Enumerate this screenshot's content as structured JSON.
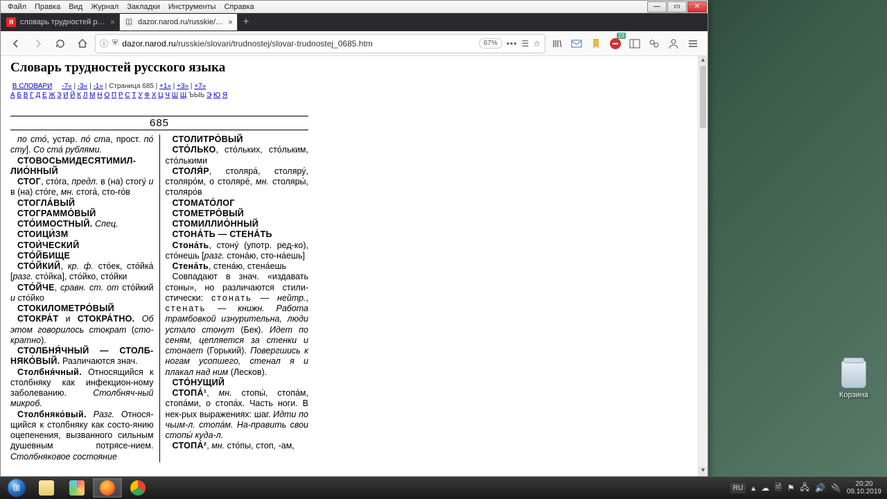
{
  "menubar": [
    "Файл",
    "Правка",
    "Вид",
    "Журнал",
    "Закладки",
    "Инструменты",
    "Справка"
  ],
  "tabs": [
    {
      "label": "словарь трудностей русского",
      "favicon": "Я",
      "active": false
    },
    {
      "label": "dazor.narod.ru/russkie/slovari/",
      "favicon": "◫",
      "active": true
    }
  ],
  "url": {
    "scheme_icon": "ⓘ",
    "shield_icon": "🛡",
    "host": "dazor.narod.ru",
    "path": "/russkie/slovari/trudnostej/slovar-trudnostej_0685.htm",
    "zoom": "67%"
  },
  "toolbar_badge": "23",
  "page": {
    "title": "Словарь трудностей русского языка",
    "back_link": "В СЛОВАРИ",
    "pager": [
      "-7«",
      "-3«",
      "-1«",
      "Страница  685",
      "+1»",
      "+3»",
      "+7»"
    ],
    "alphabet": [
      "А",
      "Б",
      "В",
      "Г",
      "Д",
      "Е",
      "Ж",
      "З",
      "И",
      "Й",
      "К",
      "Л",
      "М",
      "Н",
      "О",
      "П",
      "Р",
      "С",
      "Т",
      "У",
      "Ф",
      "Х",
      "Ц",
      "Ч",
      "Ш",
      "Щ",
      "ЪЫЬ",
      "Э",
      "Ю",
      "Я"
    ],
    "pagenum": "685",
    "col1": [
      {
        "html": "<span class='it'>по сто́</span>, устар. <span class='it'>по́ ста</span>, прост. <span class='it'>по́ сту</span>]. <span class='it'>Со ста́ рублями.</span>"
      },
      {
        "html": "<span class='hw'>СТОВОСЬМИДЕСЯТИМИЛ-ЛИО́ННЫЙ</span>"
      },
      {
        "html": "<span class='hw'>СТОГ</span>, сто́га, <span class='it'>предл.</span> в (на) стогу́ <span class='it'>и</span> в (на) сто́ге, <span class='it'>мн.</span> стога́, сто-го́в"
      },
      {
        "html": "<span class='hw'>СТОГЛА́ВЫЙ</span>"
      },
      {
        "html": "<span class='hw'>СТОГРАММО́ВЫЙ</span>"
      },
      {
        "html": "<span class='hw'>СТО́ИМОСТНЫЙ.</span> <span class='it'>Спец.</span>"
      },
      {
        "html": "<span class='hw'>СТОИЦИ́ЗМ</span>"
      },
      {
        "html": "<span class='hw'>СТОИ́ЧЕСКИЙ</span>"
      },
      {
        "html": "<span class='hw'>СТО́ЙБИЩЕ</span>"
      },
      {
        "html": "<span class='hw'>СТО́ЙКИЙ</span>, <span class='it'>кр. ф.</span> сто́ек, сто́йка́ [<span class='it'>разг.</span> сто́йка], сто́йко, сто́йки"
      },
      {
        "html": "<span class='hw'>СТО́ЙЧЕ</span>, <span class='it'>сравн. ст. от</span> сто́йкий <span class='it'>и</span> сто́йко"
      },
      {
        "html": "<span class='hw'>СТОКИЛОМЕТРО́ВЫЙ</span>"
      },
      {
        "html": "<span class='hw'>СТОКРА́Т</span> и <span class='hw'>СТОКРА́ТНО.</span> <span class='it'>Об этом говорилось стократ</span> (<span class='it'>сто-кратно</span>)."
      },
      {
        "html": "<span class='hw'>СТОЛБНЯ́ЧНЫЙ — СТОЛБ-НЯКО́ВЫЙ.</span> Различаются знач."
      },
      {
        "html": "<span class='hw'>Столбня́чный.</span> Относящийся к столбняку как инфекцион-ному заболеванию. <span class='it'>Столбняч-ный микроб.</span>"
      },
      {
        "html": "<span class='hw'>Столбняко́вый.</span> <span class='it'>Разг.</span> Относя-щийся к столбняку как состо-янию оцепенения, вызванного сильным душевным потрясе-нием. <span class='it'>Столбняковое состояние</span>"
      }
    ],
    "col2": [
      {
        "html": "<span class='hw'>СТОЛИТРО́ВЫЙ</span>"
      },
      {
        "html": "<span class='hw'>СТО́ЛЬКО</span>, сто́льких, сто́льким, сто́лькими"
      },
      {
        "html": "<span class='hw'>СТОЛЯ́Р</span>, столяра́, столяру́, столяро́м, о столяре́, <span class='it'>мн.</span> столяры́, столяро́в"
      },
      {
        "html": "<span class='hw'>СТОМАТО́ЛОГ</span>"
      },
      {
        "html": "<span class='hw'>СТОМЕТРО́ВЫЙ</span>"
      },
      {
        "html": "<span class='hw'>СТОМИЛЛИО́ННЫЙ</span>"
      },
      {
        "html": "<span class='hw'>СТОНА́ТЬ — СТЕНА́ТЬ</span>"
      },
      {
        "html": "<span class='hw'>Стона́ть</span>, стону́ (употр. ред-ко), сто́нешь [<span class='it'>разг.</span> стона́ю, сто-на́ешь]"
      },
      {
        "html": "<span class='hw'>Стена́ть</span>, стена́ю, стена́ешь"
      },
      {
        "html": "Совпадают в знач. «издавать стоны», но различаются стили-стически: <span class='sp'>стонать</span> — <span class='it'>нейтр.</span>, <span class='sp'>стенать</span> — <span class='it'>книжн.</span> <span class='it'>Работа трамбовкой изнурительна, люди устало стонут</span> (Бек). <span class='it'>Идет по сеням, цепляется за стенки и стонает</span> (Горький). <span class='it'>Повергшись к ногам усопшего, стенал я и плакал над ним</span> (Лесков)."
      },
      {
        "html": "<span class='hw'>СТО́НУЩИЙ</span>"
      },
      {
        "html": "<span class='hw'>СТОПА́¹</span>, <span class='it'>мн.</span> стопы́, стопа́м, стопа́ми, о стопа́х. Часть ноги. В нек-рых выражениях: шаг. <span class='it'>Идти по чьим-л. стопа́м. На-править свои стопы́ куда-л.</span>"
      },
      {
        "html": "<span class='hw'>СТОПА́²</span>, <span class='it'>мн.</span> сто́пы, стоп, -ам,"
      }
    ]
  },
  "desktop": {
    "trash_label": "Корзина"
  },
  "tray": {
    "lang": "RU",
    "time": "20:20",
    "date": "09.10.2019"
  }
}
